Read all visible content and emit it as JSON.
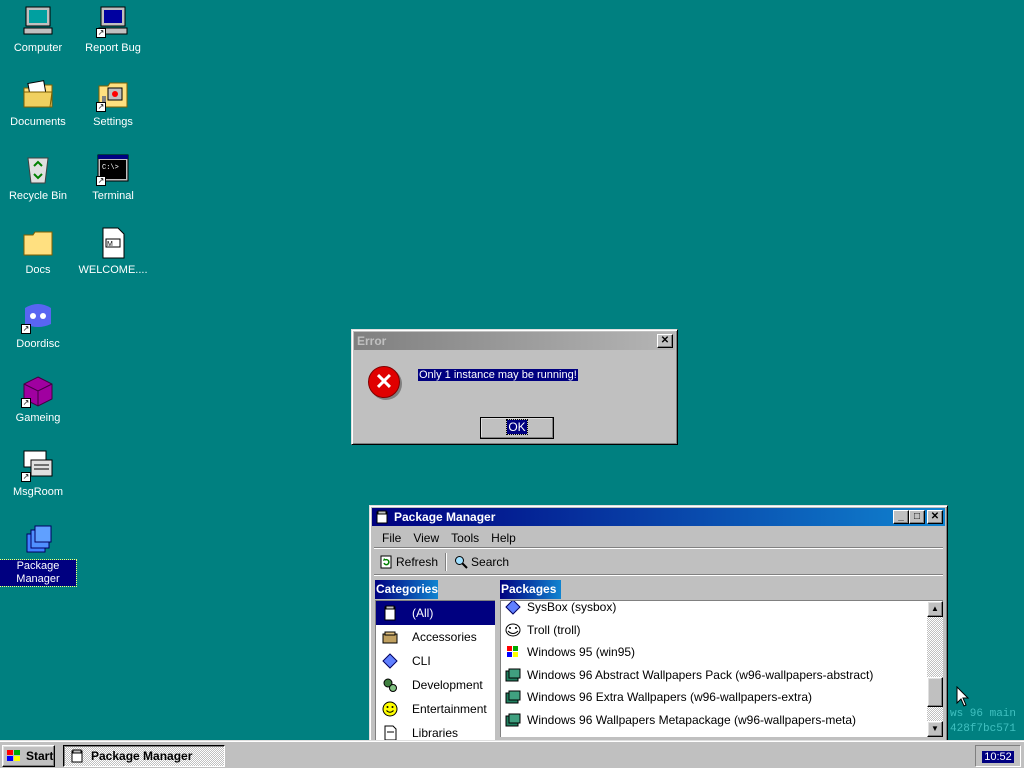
{
  "desktop": {
    "icons": [
      {
        "label": "Computer",
        "icon": "computer-icon",
        "shortcut": false
      },
      {
        "label": "Report Bug",
        "icon": "monitor-icon",
        "shortcut": true
      },
      {
        "label": "Documents",
        "icon": "documents-folder-icon",
        "shortcut": false
      },
      {
        "label": "Settings",
        "icon": "settings-icon",
        "shortcut": true
      },
      {
        "label": "Recycle Bin",
        "icon": "recycle-bin-icon",
        "shortcut": false
      },
      {
        "label": "Terminal",
        "icon": "terminal-icon",
        "shortcut": true
      },
      {
        "label": "Docs",
        "icon": "folder-icon",
        "shortcut": false
      },
      {
        "label": "WELCOME....",
        "icon": "markdown-file-icon",
        "shortcut": false
      },
      {
        "label": "Doordisc",
        "icon": "doordisc-icon",
        "shortcut": true
      },
      {
        "label": "Gameing",
        "icon": "cube-icon",
        "shortcut": true
      },
      {
        "label": "MsgRoom",
        "icon": "msgroom-icon",
        "shortcut": true
      },
      {
        "label": "Package Manager",
        "icon": "package-manager-icon",
        "shortcut": false,
        "selected": true
      }
    ]
  },
  "error_dialog": {
    "title": "Error",
    "message": "Only 1 instance may be running!",
    "ok_label": "OK",
    "icon": "error-icon"
  },
  "package_manager": {
    "title": "Package Manager",
    "menu": [
      "File",
      "View",
      "Tools",
      "Help"
    ],
    "toolbar": {
      "refresh_label": "Refresh",
      "search_label": "Search"
    },
    "categories_header": "Categories",
    "packages_header": "Packages",
    "categories": [
      {
        "label": "(All)",
        "icon": "all-icon",
        "selected": true
      },
      {
        "label": "Accessories",
        "icon": "accessories-icon"
      },
      {
        "label": "CLI",
        "icon": "cli-diamond-icon"
      },
      {
        "label": "Development",
        "icon": "development-icon"
      },
      {
        "label": "Entertainment",
        "icon": "smiley-icon"
      },
      {
        "label": "Libraries",
        "icon": "libraries-icon"
      }
    ],
    "packages": [
      {
        "label": "SysBox (sysbox)",
        "icon": "diamond-icon"
      },
      {
        "label": "Troll (troll)",
        "icon": "troll-icon"
      },
      {
        "label": "Windows 95 (win95)",
        "icon": "windows-icon"
      },
      {
        "label": "Windows 96 Abstract Wallpapers Pack (w96-wallpapers-abstract)",
        "icon": "package-icon"
      },
      {
        "label": "Windows 96 Extra Wallpapers (w96-wallpapers-extra)",
        "icon": "package-icon"
      },
      {
        "label": "Windows 96 Wallpapers Metapackage (w96-wallpapers-meta)",
        "icon": "package-icon"
      }
    ]
  },
  "background_terminal_text": [
    "ws 96 main",
    "428f7bc571"
  ],
  "taskbar": {
    "start_label": "Start",
    "task_label": "Package Manager",
    "clock": "10:52"
  }
}
